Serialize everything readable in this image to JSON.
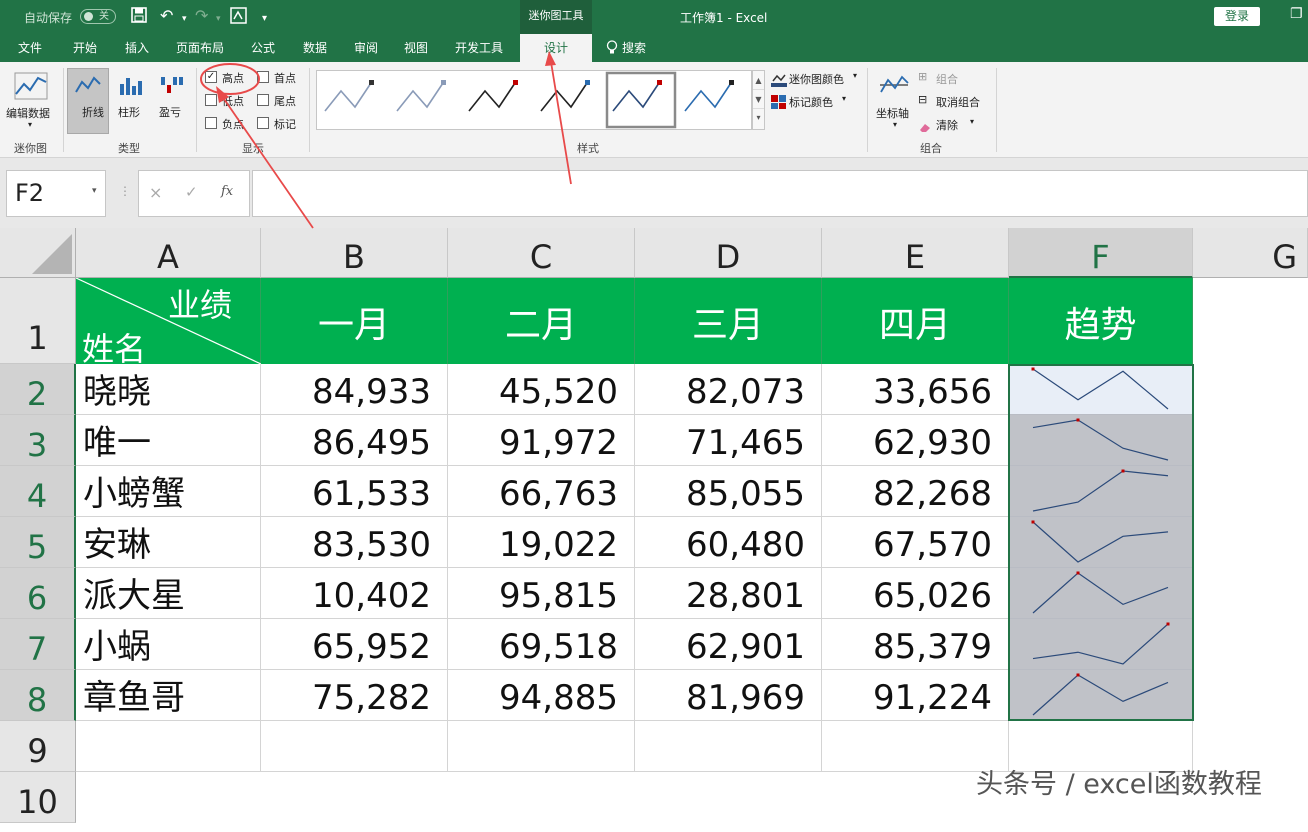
{
  "titlebar": {
    "autosave_label": "自动保存",
    "autosave_state": "关",
    "context_tool": "迷你图工具",
    "doc_title": "工作簿1  -  Excel",
    "login": "登录",
    "restore_symbol": "❐"
  },
  "tabs": [
    "文件",
    "开始",
    "插入",
    "页面布局",
    "公式",
    "数据",
    "审阅",
    "视图",
    "开发工具",
    "设计",
    "搜索"
  ],
  "ribbon": {
    "sparkline": {
      "edit": "编辑数据",
      "group": "迷你图"
    },
    "type": {
      "line": "折线",
      "column": "柱形",
      "winloss": "盈亏",
      "group": "类型"
    },
    "show": {
      "group": "显示",
      "items": [
        {
          "label": "高点",
          "checked": true
        },
        {
          "label": "低点",
          "checked": false
        },
        {
          "label": "负点",
          "checked": false
        },
        {
          "label": "首点",
          "checked": false
        },
        {
          "label": "尾点",
          "checked": false
        },
        {
          "label": "标记",
          "checked": false
        }
      ]
    },
    "style": {
      "group": "样式",
      "color_btn": "迷你图颜色",
      "marker_btn": "标记颜色"
    },
    "grouping": {
      "axis": "坐标轴",
      "combine": "组合",
      "ungroup": "取消组合",
      "clear": "清除",
      "group": "组合"
    }
  },
  "formula": {
    "namebox": "F2",
    "fx": "fx"
  },
  "columns": [
    "A",
    "B",
    "C",
    "D",
    "E",
    "F",
    "G"
  ],
  "rows": [
    "1",
    "2",
    "3",
    "4",
    "5",
    "6",
    "7",
    "8",
    "9",
    "10"
  ],
  "header": {
    "corner_top": "业绩",
    "corner_bottom": "姓名",
    "months": [
      "一月",
      "二月",
      "三月",
      "四月"
    ],
    "trend": "趋势"
  },
  "table": [
    {
      "name": "晓晓",
      "values": [
        "84,933",
        "45,520",
        "82,073",
        "33,656"
      ]
    },
    {
      "name": "唯一",
      "values": [
        "86,495",
        "91,972",
        "71,465",
        "62,930"
      ]
    },
    {
      "name": "小螃蟹",
      "values": [
        "61,533",
        "66,763",
        "85,055",
        "82,268"
      ]
    },
    {
      "name": "安琳",
      "values": [
        "83,530",
        "19,022",
        "60,480",
        "67,570"
      ]
    },
    {
      "name": "派大星",
      "values": [
        "10,402",
        "95,815",
        "28,801",
        "65,026"
      ]
    },
    {
      "name": "小蜗",
      "values": [
        "65,952",
        "69,518",
        "62,901",
        "85,379"
      ]
    },
    {
      "name": "章鱼哥",
      "values": [
        "75,282",
        "94,885",
        "81,969",
        "91,224"
      ]
    }
  ],
  "sparkline_data": [
    [
      84933,
      45520,
      82073,
      33656
    ],
    [
      86495,
      91972,
      71465,
      62930
    ],
    [
      61533,
      66763,
      85055,
      82268
    ],
    [
      83530,
      19022,
      60480,
      67570
    ],
    [
      10402,
      95815,
      28801,
      65026
    ],
    [
      65952,
      69518,
      62901,
      85379
    ],
    [
      75282,
      94885,
      81969,
      91224
    ]
  ],
  "colors": {
    "excel_green": "#217346",
    "header_green": "#00b050",
    "line_color": "#2b4a7a",
    "high_point": "#c00000",
    "annotation": "#e84a4a"
  },
  "watermark": "头条号 / excel函数教程"
}
